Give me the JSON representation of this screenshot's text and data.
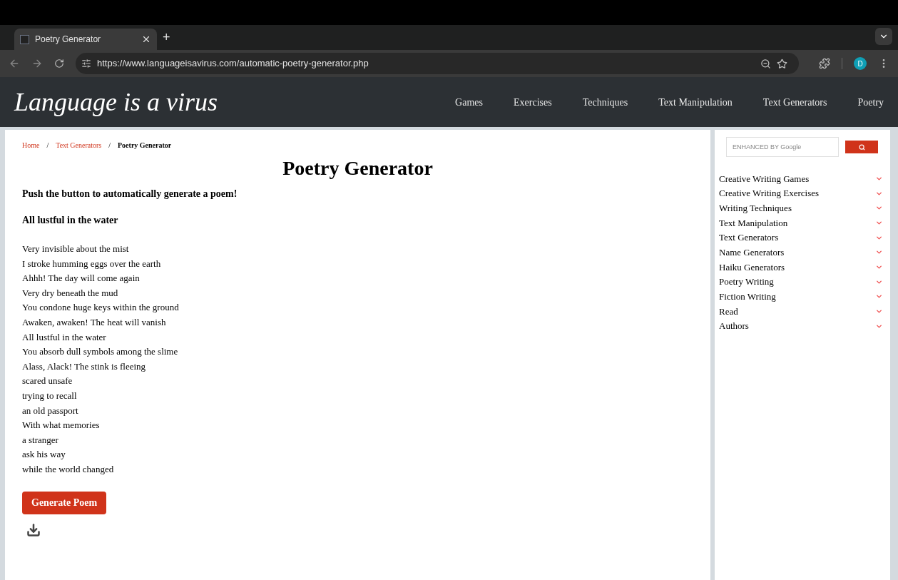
{
  "browser": {
    "tab_title": "Poetry Generator",
    "new_tab": "+",
    "url": "https://www.languageisavirus.com/automatic-poetry-generator.php",
    "profile_initial": "D"
  },
  "site": {
    "logo": "Language is a virus",
    "nav": [
      "Games",
      "Exercises",
      "Techniques",
      "Text Manipulation",
      "Text Generators",
      "Poetry"
    ]
  },
  "breadcrumb": [
    {
      "label": "Home",
      "link": true
    },
    {
      "separator": "/",
      "label": "Text Generators",
      "link": true
    },
    {
      "separator": "/",
      "label": "Poetry Generator",
      "link": false
    }
  ],
  "page_title": "Poetry Generator",
  "intro": "Push the button to automatically generate a poem!",
  "poem_title": "All lustful in the water",
  "poem_lines": [
    "Very invisible about the mist",
    "I stroke humming eggs over the earth",
    "Ahhh! The day will come again",
    "Very dry beneath the mud",
    "You condone huge keys within the ground",
    "Awaken, awaken! The heat will vanish",
    "All lustful in the water",
    "You absorb dull symbols among the slime",
    "Alass, Alack! The stink is fleeing",
    "scared unsafe",
    "trying to recall",
    "an old passport",
    "With what memories",
    "a stranger",
    "ask his way",
    "while the world changed"
  ],
  "generate_button": "Generate Poem",
  "search": {
    "placeholder": "ENHANCED BY Google"
  },
  "sidebar_menu": [
    {
      "label": "Creative Writing Games",
      "expanded": false
    },
    {
      "label": "Creative Writing Exercises",
      "expanded": false
    },
    {
      "label": "Writing Techniques",
      "expanded": false
    },
    {
      "label": "Text Manipulation",
      "expanded": false
    },
    {
      "label": "Text Generators",
      "expanded": false
    },
    {
      "label": "Name Generators",
      "expanded": false
    },
    {
      "label": "Haiku Generators",
      "expanded": false
    },
    {
      "label": "Poetry Writing",
      "expanded": false
    },
    {
      "label": "Fiction Writing",
      "expanded": false
    },
    {
      "label": "Read",
      "expanded": false
    },
    {
      "label": "Authors",
      "expanded": false
    }
  ]
}
